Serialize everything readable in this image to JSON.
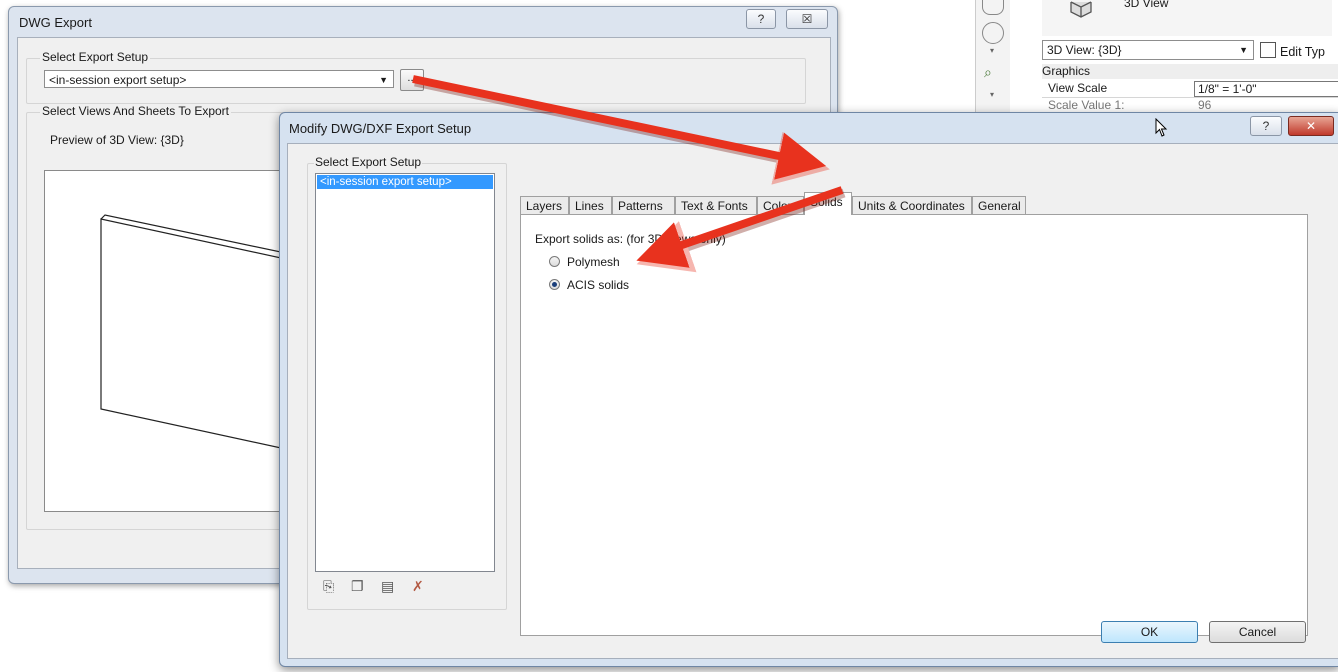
{
  "dwg_export": {
    "title": "DWG Export",
    "help_label": "?",
    "close_label": "☒",
    "select_setup_label": "Select Export Setup",
    "setup_value": "<in-session export setup>",
    "browse_label": "...",
    "views_label": "Select Views And Sheets To Export",
    "preview_label": "Preview of 3D View: {3D}"
  },
  "properties": {
    "type_label": "3D View",
    "view_selector": "3D View: {3D}",
    "edit_type_label": "Edit Typ",
    "section": "Graphics",
    "rows": [
      {
        "name": "View Scale",
        "value": "1/8\" = 1'-0\""
      },
      {
        "name": "Scale Value    1:",
        "value": "96"
      }
    ]
  },
  "modify_dialog": {
    "title": "Modify DWG/DXF Export Setup",
    "help_label": "?",
    "close_label": "✕",
    "setup_group_label": "Select Export Setup",
    "setups": [
      "<in-session export setup>"
    ],
    "tabs": [
      "Layers",
      "Lines",
      "Patterns",
      "Text & Fonts",
      "Colors",
      "Solids",
      "Units & Coordinates",
      "General"
    ],
    "active_tab": "Solids",
    "export_solids_label": "Export solids as: (for 3D views only)",
    "options": [
      {
        "label": "Polymesh",
        "selected": false
      },
      {
        "label": "ACIS solids",
        "selected": true
      }
    ],
    "ok_label": "OK",
    "cancel_label": "Cancel"
  }
}
